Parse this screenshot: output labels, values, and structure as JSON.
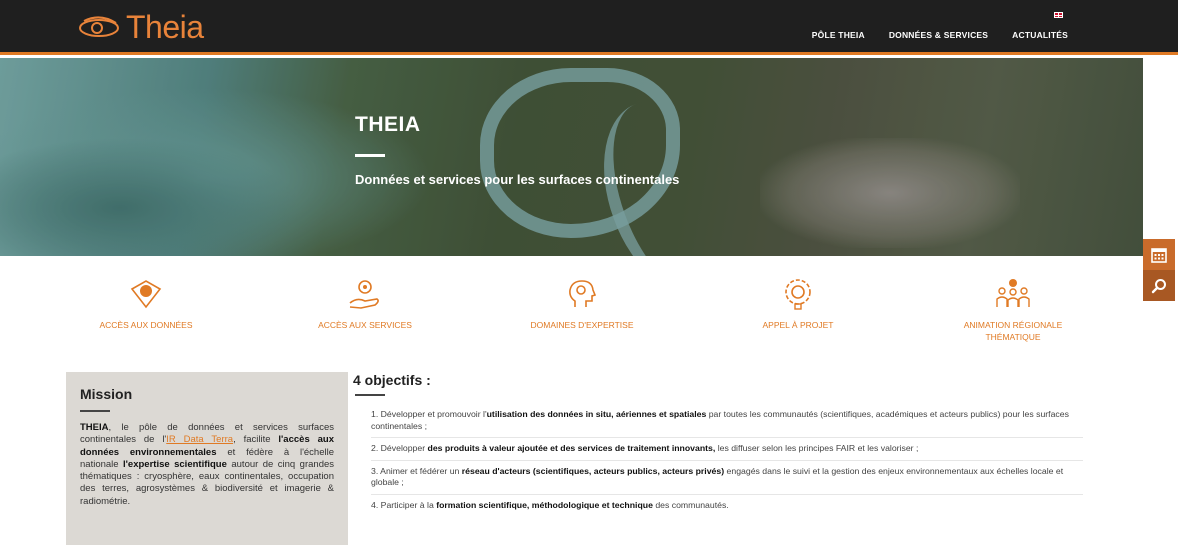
{
  "header": {
    "logo_text": "Theia",
    "nav": [
      {
        "label": "PÔLE THEIA"
      },
      {
        "label": "DONNÉES & SERVICES"
      },
      {
        "label": "ACTUALITÉS"
      }
    ]
  },
  "hero": {
    "title": "THEIA",
    "subtitle": "Données et services pour les surfaces continentales"
  },
  "features": [
    {
      "label": "ACCÈS AUX DONNÉES",
      "icon": "data-access-icon"
    },
    {
      "label": "ACCÈS AUX SERVICES",
      "icon": "services-access-icon"
    },
    {
      "label": "DOMAINES D'EXPERTISE",
      "icon": "expertise-icon"
    },
    {
      "label": "APPEL À PROJET",
      "icon": "project-call-icon"
    },
    {
      "label": "ANIMATION RÉGIONALE THÉMATIQUE",
      "icon": "regional-animation-icon"
    }
  ],
  "mission": {
    "title": "Mission",
    "p1": "THEIA",
    "p2": ", le pôle de données et services surfaces continentales de l'",
    "link": "IR Data Terra",
    "p3": ", facilite ",
    "p4": "l'accès aux données environnementales",
    "p5": " et fédère à l'échelle nationale ",
    "p6": "l'expertise scientifique",
    "p7": " autour de cinq grandes thématiques : cryosphère, eaux continentales, occupation des terres, agrosystèmes & biodiversité et imagerie & radiométrie."
  },
  "objectives": {
    "title": "4 objectifs :",
    "items": [
      {
        "pre": "1. Développer et promouvoir l'",
        "bold": "utilisation des données in situ, aériennes et spatiales",
        "post": " par toutes les communautés (scientifiques, académiques et acteurs publics) pour les surfaces continentales ;"
      },
      {
        "pre": "2. Développer ",
        "bold": "des produits à valeur ajoutée et des services de traitement innovants,",
        "post": " les diffuser selon les principes FAIR et les valoriser ;"
      },
      {
        "pre": "3. Animer et fédérer un ",
        "bold": "réseau d'acteurs (scientifiques, acteurs publics, acteurs privés)",
        "post": " engagés dans le suivi et la gestion des enjeux environnementaux aux échelles locale et globale ;"
      },
      {
        "pre": "4. Participer à la ",
        "bold": "formation scientifique, méthodologique et technique",
        "post": " des communautés."
      }
    ]
  },
  "side": {
    "calendar_icon": "calendar-icon",
    "search_icon": "search-icon"
  },
  "colors": {
    "accent": "#e07a24",
    "header_bg": "#1f1f1f",
    "mission_bg": "#dcd9d4"
  }
}
